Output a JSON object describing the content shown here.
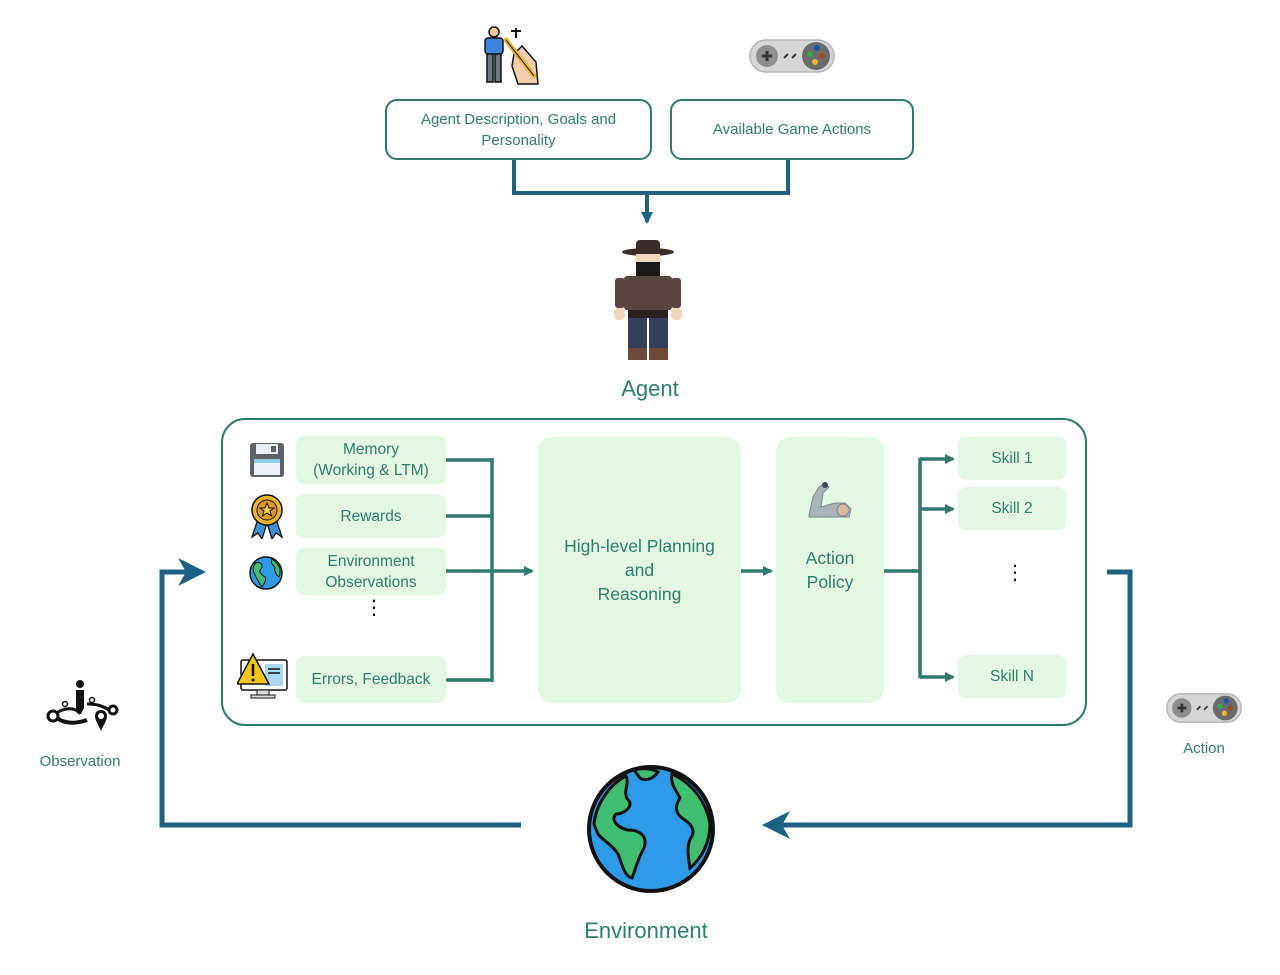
{
  "inputs": {
    "agent_description": "Agent Description, Goals and Personality",
    "game_actions": "Available Game Actions"
  },
  "agent": {
    "label": "Agent"
  },
  "sources": [
    {
      "label": "Memory\n(Working & LTM)",
      "icon": "floppy-disk-icon"
    },
    {
      "label": "Rewards",
      "icon": "medal-icon"
    },
    {
      "label": "Environment Observations",
      "icon": "globe-icon"
    },
    {
      "label": "Errors, Feedback",
      "icon": "warning-monitor-icon"
    }
  ],
  "planning": {
    "label_line1": "High-level Planning",
    "label_line2": "and",
    "label_line3": "Reasoning"
  },
  "policy": {
    "label_line1": "Action",
    "label_line2": "Policy",
    "icon": "robot-arm-icon"
  },
  "skills": [
    "Skill 1",
    "Skill 2",
    "Skill N"
  ],
  "ellipsis": "⋮",
  "loop": {
    "observation_label": "Observation",
    "action_label": "Action",
    "environment_label": "Environment"
  },
  "colors": {
    "text_teal": "#2e7d6e",
    "connector_teal": "#2e7a70",
    "loop_blue": "#1e6283",
    "box_fill": "#e3f8e3"
  }
}
